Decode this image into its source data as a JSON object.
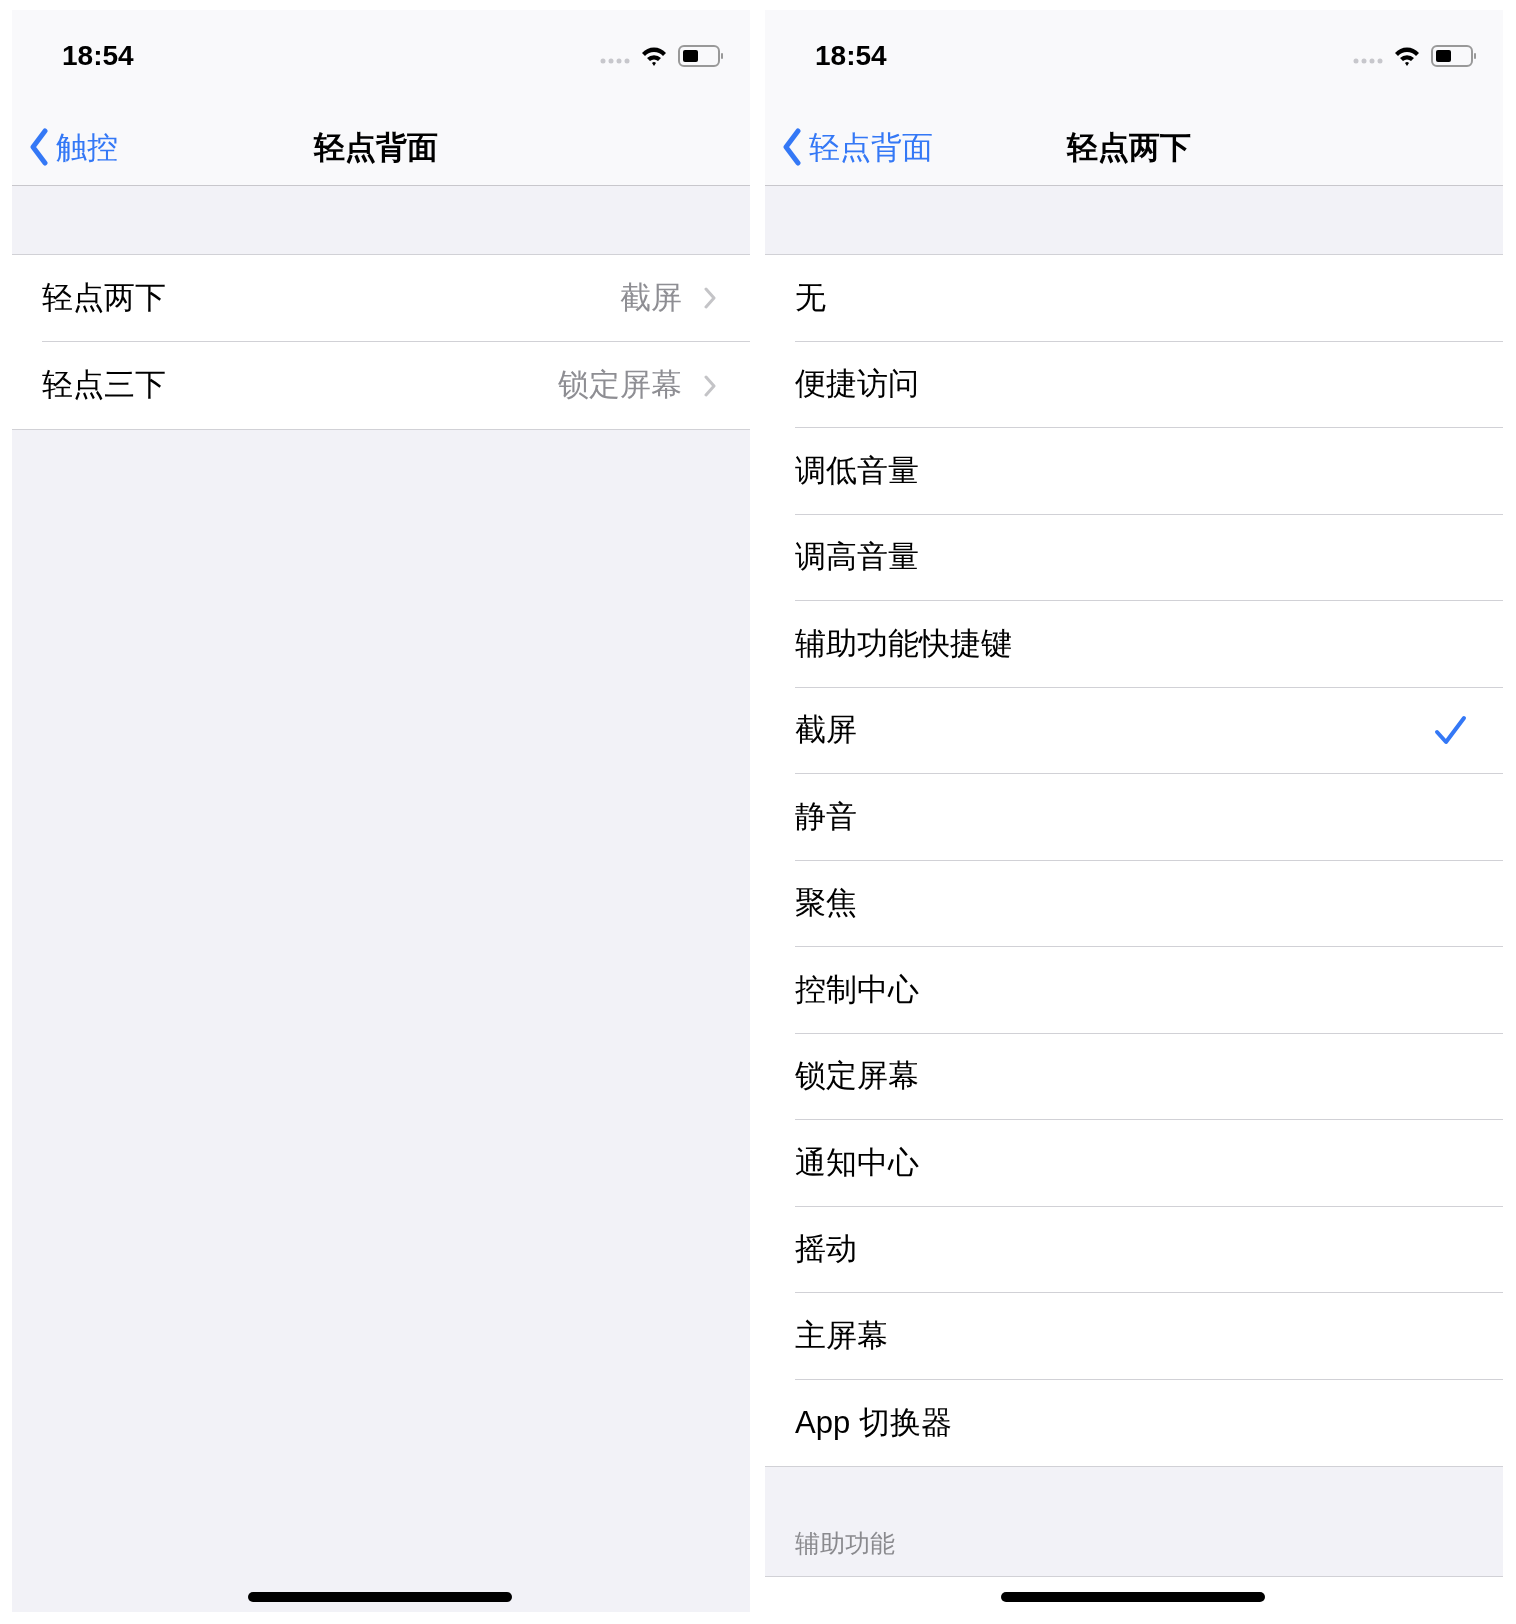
{
  "left_screen": {
    "status_bar": {
      "time": "18:54"
    },
    "nav": {
      "back": "触控",
      "title": "轻点背面"
    },
    "rows": [
      {
        "label": "轻点两下",
        "value": "截屏"
      },
      {
        "label": "轻点三下",
        "value": "锁定屏幕"
      }
    ]
  },
  "right_screen": {
    "status_bar": {
      "time": "18:54"
    },
    "nav": {
      "back": "轻点背面",
      "title": "轻点两下"
    },
    "options": [
      {
        "label": "无",
        "selected": false
      },
      {
        "label": "便捷访问",
        "selected": false
      },
      {
        "label": "调低音量",
        "selected": false
      },
      {
        "label": "调高音量",
        "selected": false
      },
      {
        "label": "辅助功能快捷键",
        "selected": false
      },
      {
        "label": "截屏",
        "selected": true
      },
      {
        "label": "静音",
        "selected": false
      },
      {
        "label": "聚焦",
        "selected": false
      },
      {
        "label": "控制中心",
        "selected": false
      },
      {
        "label": "锁定屏幕",
        "selected": false
      },
      {
        "label": "通知中心",
        "selected": false
      },
      {
        "label": "摇动",
        "selected": false
      },
      {
        "label": "主屏幕",
        "selected": false
      },
      {
        "label": "App 切换器",
        "selected": false
      }
    ],
    "section_header": "辅助功能"
  }
}
